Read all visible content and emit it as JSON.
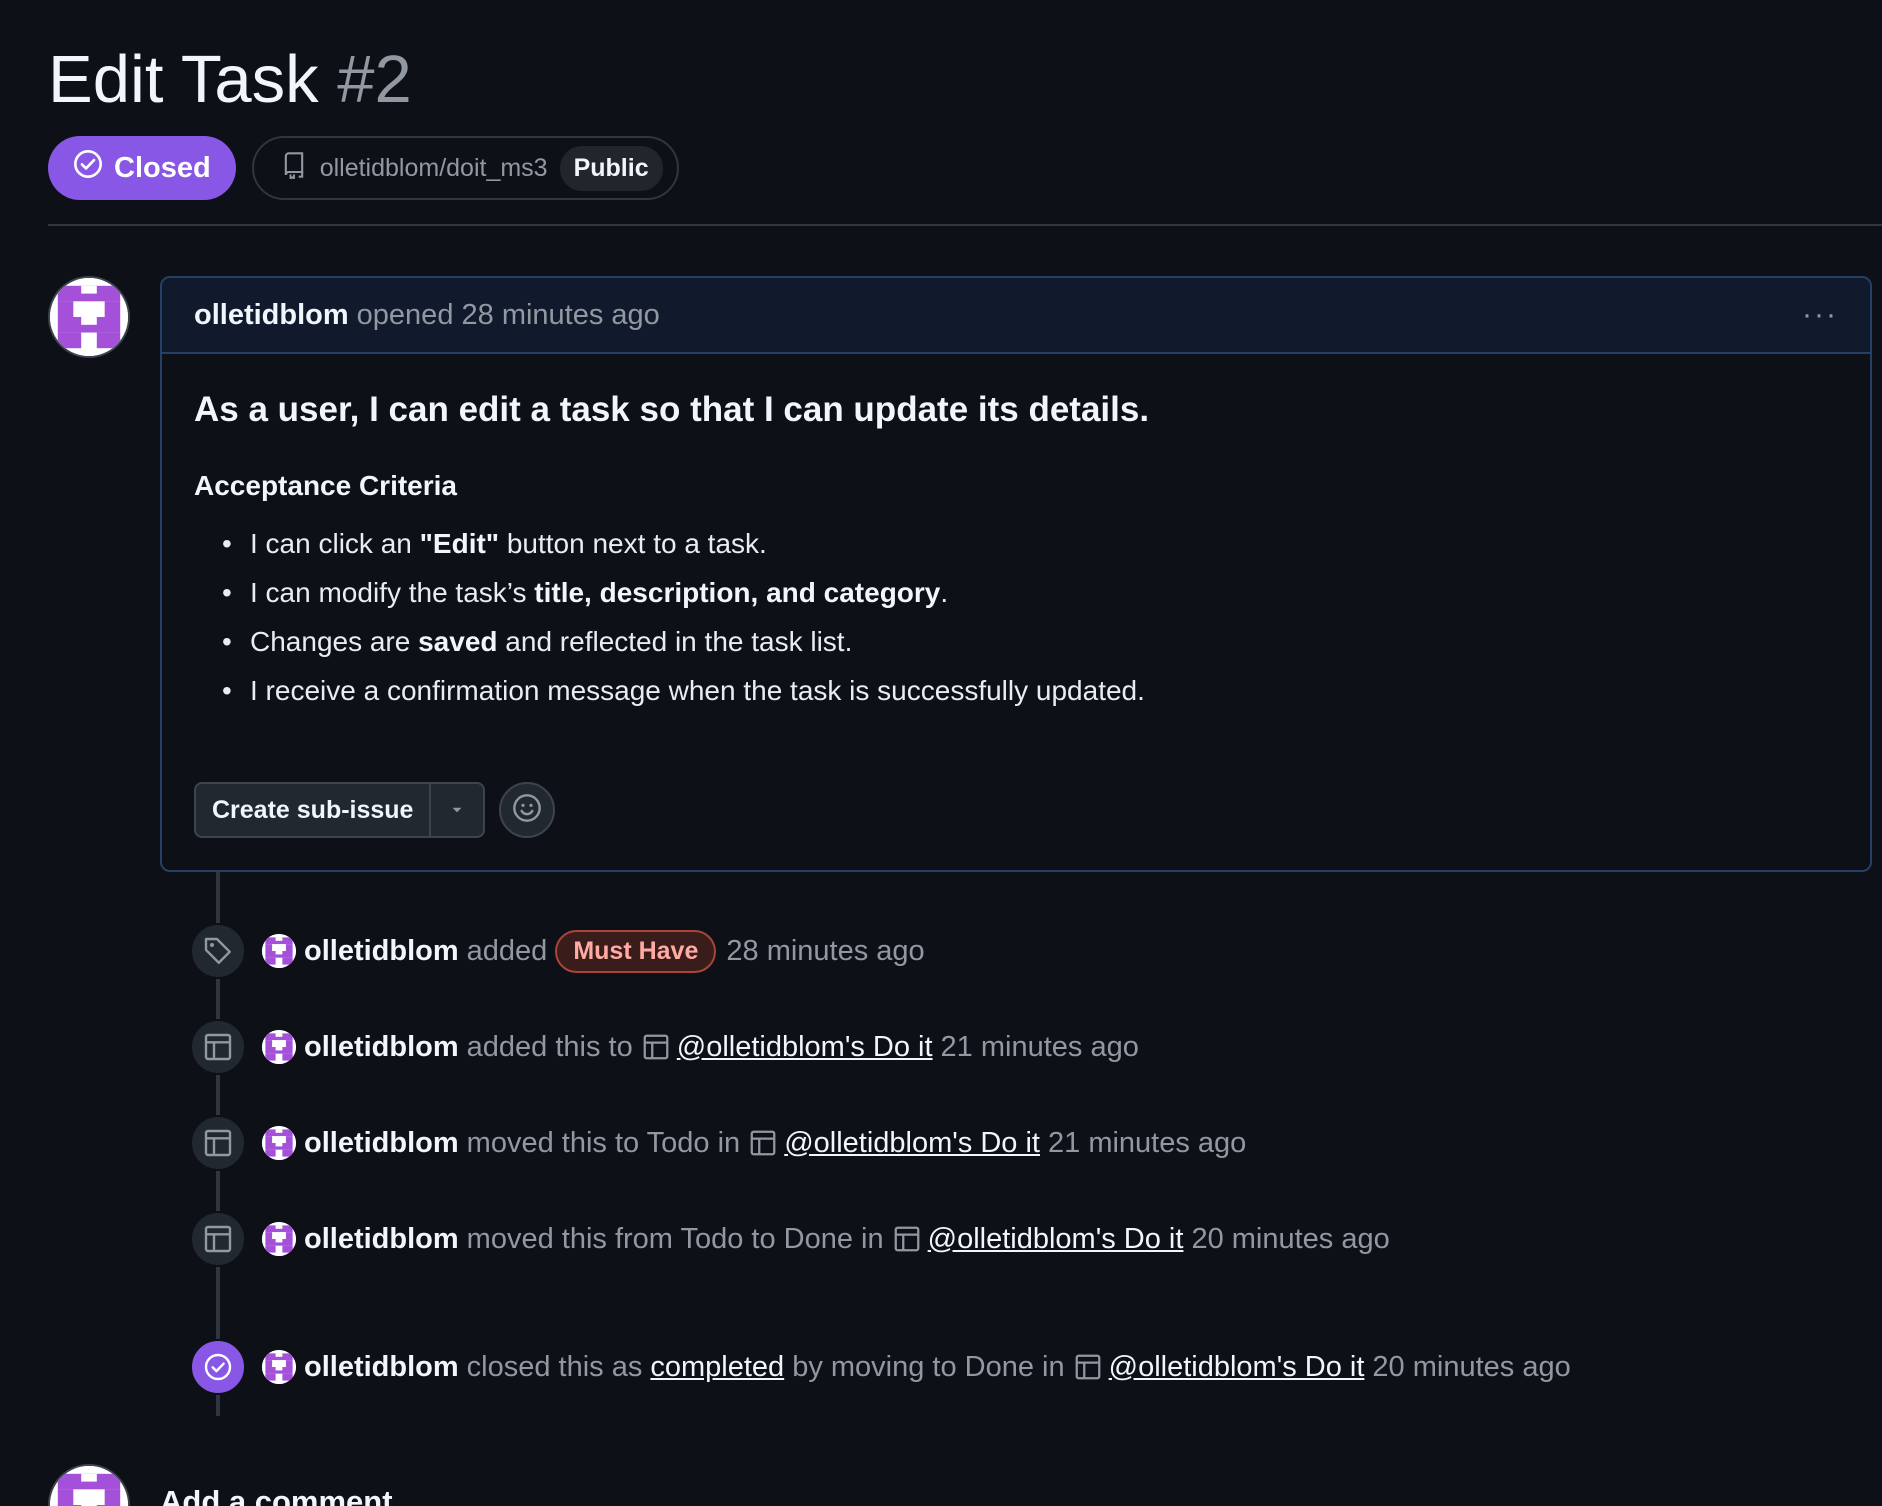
{
  "issue": {
    "title": "Edit Task",
    "number": "#2",
    "state": "Closed",
    "repo": "olletidblom/doit_ms3",
    "visibility": "Public"
  },
  "comment": {
    "author": "olletidblom",
    "opened": "opened 28 minutes ago",
    "menu": "···",
    "story": "As a user, I can edit a task so that I can update its details.",
    "criteria_heading": "Acceptance Criteria",
    "criteria": [
      {
        "a": "I can click an ",
        "b": "\"Edit\"",
        "c": " button next to a task."
      },
      {
        "a": "I can modify the task’s ",
        "b": "title, description, and category",
        "c": "."
      },
      {
        "a": "Changes are ",
        "b": "saved",
        "c": " and reflected in the task list."
      },
      {
        "a": "I receive a confirmation message when the task is successfully updated.",
        "b": "",
        "c": ""
      }
    ],
    "create_subissue": "Create sub-issue"
  },
  "events": [
    {
      "user": "olletidblom",
      "text": "added",
      "label": "Must Have",
      "time": "28 minutes ago"
    },
    {
      "user": "olletidblom",
      "text": "added this to",
      "project": "@olletidblom's Do it",
      "time": "21 minutes ago"
    },
    {
      "user": "olletidblom",
      "text": "moved this to Todo in",
      "project": "@olletidblom's Do it",
      "time": "21 minutes ago"
    },
    {
      "user": "olletidblom",
      "text": "moved this from Todo to Done in",
      "project": "@olletidblom's Do it",
      "time": "20 minutes ago"
    },
    {
      "user": "olletidblom",
      "text": "closed this as",
      "link": "completed",
      "text2": "by moving to Done in",
      "project": "@olletidblom's Do it",
      "time": "20 minutes ago"
    }
  ],
  "footer": {
    "add_comment": "Add a comment"
  },
  "colors": {
    "accent_purple": "#8957e5",
    "bg": "#0d1117",
    "label_red": "#ffaba3"
  },
  "icons": [
    "check-circle-icon",
    "repo-icon",
    "kebab-icon",
    "smiley-icon",
    "tag-icon",
    "project-table-icon",
    "chevron-down-icon"
  ]
}
